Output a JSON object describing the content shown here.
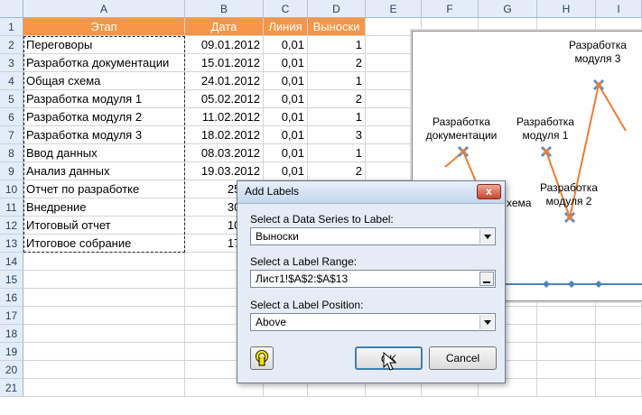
{
  "columns": [
    "A",
    "B",
    "C",
    "D",
    "E",
    "F",
    "G",
    "H",
    "I"
  ],
  "rows": [
    "1",
    "2",
    "3",
    "4",
    "5",
    "6",
    "7",
    "8",
    "9",
    "10",
    "11",
    "12",
    "13",
    "14",
    "15",
    "16",
    "17",
    "18",
    "19",
    "20",
    "21"
  ],
  "table": {
    "headers": [
      "Этап",
      "Дата",
      "Линия",
      "Выноски"
    ],
    "header_color": "#f79646",
    "data": [
      [
        "Переговоры",
        "09.01.2012",
        "0,01",
        "1"
      ],
      [
        "Разработка документации",
        "15.01.2012",
        "0,01",
        "2"
      ],
      [
        "Общая схема",
        "24.01.2012",
        "0,01",
        "1"
      ],
      [
        "Разработка модуля 1",
        "05.02.2012",
        "0,01",
        "2"
      ],
      [
        "Разработка модуля 2",
        "11.02.2012",
        "0,01",
        "1"
      ],
      [
        "Разработка модуля 3",
        "18.02.2012",
        "0,01",
        "3"
      ],
      [
        "Ввод данных",
        "08.03.2012",
        "0,01",
        "1"
      ],
      [
        "Анализ данных",
        "19.03.2012",
        "0,01",
        "2"
      ],
      [
        "Отчет по разработке",
        "25.03.",
        "",
        ""
      ],
      [
        "Внедрение",
        "30.03.",
        "",
        ""
      ],
      [
        "Итоговый отчет",
        "10.04.",
        "",
        ""
      ],
      [
        "Итоговое собрание",
        "17.04.",
        "",
        ""
      ]
    ]
  },
  "chart": {
    "line_color": "#ed7d31",
    "axis_color": "#4f81bd",
    "labels": {
      "doc": "Разработка документации",
      "mod1": "Разработка модуля 1",
      "mod2": "Разработка модуля 2",
      "mod3": "Разработка модуля 3",
      "scheme_fragment": "хема"
    }
  },
  "dialog": {
    "title": "Add Labels",
    "close_glyph": "x",
    "series_label": "Select a Data Series to Label:",
    "series_value": "Выноски",
    "range_label": "Select a Label Range:",
    "range_value": "Лист1!$A$2:$A$13",
    "position_label": "Select a Label Position:",
    "position_value": "Above",
    "ok_label": "OK",
    "cancel_label": "Cancel",
    "help_icon": "question-icon"
  }
}
